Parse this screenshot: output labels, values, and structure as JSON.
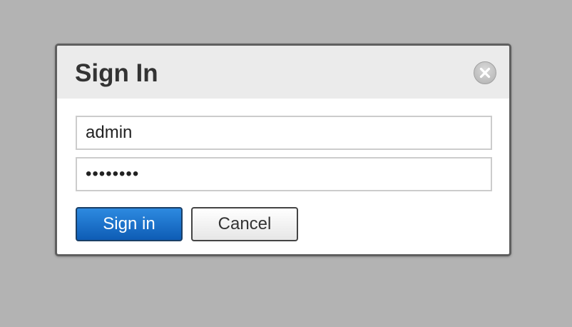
{
  "dialog": {
    "title": "Sign In",
    "close_icon": "close-circle-icon",
    "username": {
      "value": "admin",
      "placeholder": ""
    },
    "password": {
      "value": "password",
      "placeholder": ""
    },
    "signin_label": "Sign in",
    "cancel_label": "Cancel"
  },
  "colors": {
    "backdrop": "#b3b3b3",
    "header": "#ebebeb",
    "primary_button": "#1a6fc9",
    "dialog_border": "#5f5f5f"
  }
}
